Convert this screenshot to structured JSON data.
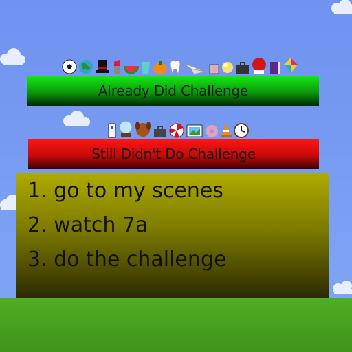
{
  "scene": {
    "sky_color": "#7597f0",
    "ground_color": "#48a31e"
  },
  "already_did": {
    "label": "Already Did Challenge",
    "color": "#14e914",
    "characters": [
      "soccer-ball-icon",
      "globe-icon",
      "top-hat-icon",
      "lipstick-icon",
      "watermelon-icon",
      "cup-icon",
      "pumpkin-icon",
      "tooth-icon",
      "paper-plane-icon",
      "cube-icon",
      "popcorn-icon",
      "briefcase-icon",
      "boxing-glove-icon",
      "book-icon",
      "kite-icon"
    ]
  },
  "still_didnt": {
    "label": "Still Didn't Do Challenge",
    "color": "#ff1616",
    "characters": [
      "remote-icon",
      "snow-globe-icon",
      "dog-icon",
      "suitcase-icon",
      "peppermint-icon",
      "picture-frame-icon",
      "donut-icon",
      "cone-icon",
      "clock-icon"
    ]
  },
  "instructions": {
    "step1": "1. go to my scenes",
    "step2": "2. watch 7a",
    "step3": "3. do the challenge"
  }
}
